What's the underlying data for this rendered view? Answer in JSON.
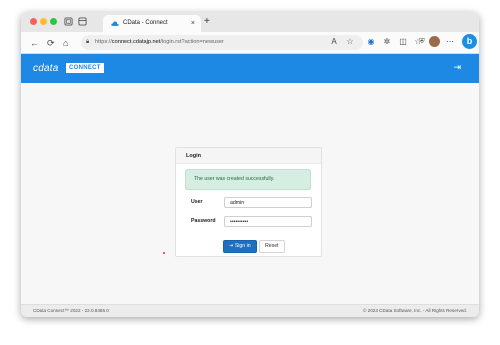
{
  "browser": {
    "tab_title": "CData - Connect",
    "tab_close": "×",
    "new_tab": "+",
    "url_prefix": "https://",
    "url_host": "connect.cdatajp.net",
    "url_path": "/login.rst?action=newuser"
  },
  "app": {
    "logo_text": "cdata",
    "logo_badge": "CONNECT",
    "brand_color": "#1e88e5"
  },
  "login": {
    "title": "Login",
    "success_message": "The user was created successfully.",
    "user_label": "User",
    "user_value": "admin",
    "password_label": "Password",
    "password_value": "••••••••••",
    "signin_label": "Sign in",
    "reset_label": "Reset"
  },
  "footer": {
    "version": "CData Connect™ 2022 - 22.0.8486.0",
    "copyright": "© 2023 CData Software, Inc. - All Rights Reserved."
  }
}
